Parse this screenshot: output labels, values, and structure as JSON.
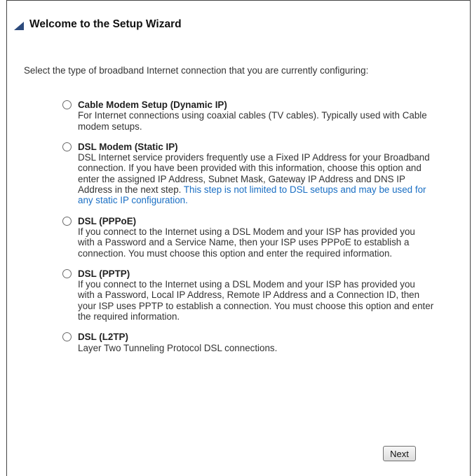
{
  "header": {
    "title": "Welcome to the Setup Wizard"
  },
  "intro": "Select the type of broadband Internet connection that you are currently configuring:",
  "options": [
    {
      "title": "Cable Modem Setup (Dynamic IP)",
      "desc": "For Internet connections using coaxial cables (TV cables). Typically used with Cable modem setups."
    },
    {
      "title": "DSL Modem (Static IP)",
      "desc": "DSL Internet service providers frequently use a Fixed IP Address for your Broadband connection. If you have been provided with this information, choose this option and enter the assigned IP Address, Subnet Mask, Gateway IP Address and DNS IP Address in the next step.",
      "note": "This step is not limited to DSL setups and may be used for any static IP configuration."
    },
    {
      "title": "DSL (PPPoE)",
      "desc": "If you connect to the Internet using a DSL Modem and your ISP has provided you with a Password and a Service Name, then your ISP uses PPPoE to establish a connection. You must choose this option and enter the required information."
    },
    {
      "title": "DSL (PPTP)",
      "desc": "If you connect to the Internet using a DSL Modem and your ISP has provided you with a Password, Local IP Address, Remote IP Address and a Connection ID, then your ISP uses PPTP to establish a connection. You must choose this option and enter the required information."
    },
    {
      "title": "DSL (L2TP)",
      "desc": "Layer Two Tunneling Protocol DSL connections."
    }
  ],
  "next_label": "Next",
  "colors": {
    "accent_triangle": "#2c4a7c",
    "link_blue": "#1a6fc4"
  }
}
